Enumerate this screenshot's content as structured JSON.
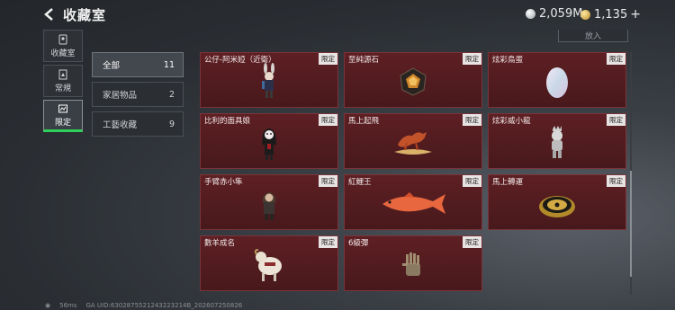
{
  "header": {
    "title": "收藏室",
    "currency_silver": "2,059M",
    "currency_gold": "1,135",
    "plus": "+"
  },
  "left_tabs": [
    {
      "label": "收藏室",
      "icon": "collection-icon"
    },
    {
      "label": "常規",
      "icon": "regular-icon"
    },
    {
      "label": "限定",
      "icon": "limited-icon",
      "active": true
    }
  ],
  "filters": [
    {
      "label": "全部",
      "count": "11",
      "active": true
    },
    {
      "label": "家居物品",
      "count": "2"
    },
    {
      "label": "工藝收藏",
      "count": "9"
    }
  ],
  "place_button": "放入",
  "items": [
    {
      "name": "公仔-阿米婭（近衛）",
      "badge": "限定",
      "icon": "rabbit-figurine-icon"
    },
    {
      "name": "至純源石",
      "badge": "限定",
      "icon": "originium-crystal-icon"
    },
    {
      "name": "炫彩鳥蛋",
      "badge": "限定",
      "icon": "iridescent-egg-icon"
    },
    {
      "name": "比利的面具娘",
      "badge": "限定",
      "icon": "masked-doll-icon"
    },
    {
      "name": "馬上起飛",
      "badge": "限定",
      "icon": "flying-horse-statue-icon"
    },
    {
      "name": "炫彩威小龍",
      "badge": "限定",
      "icon": "little-dragon-figure-icon"
    },
    {
      "name": "手臂赤小隼",
      "badge": "限定",
      "icon": "hooded-figure-icon"
    },
    {
      "name": "紅鯉王",
      "badge": "限定",
      "icon": "red-carp-icon"
    },
    {
      "name": "馬上轉運",
      "badge": "限定",
      "icon": "golden-compass-icon"
    },
    {
      "name": "數羊成名",
      "badge": "限定",
      "icon": "sheep-figure-icon"
    },
    {
      "name": "6級彈",
      "badge": "限定",
      "icon": "metal-hand-icon"
    }
  ],
  "footer": {
    "ping": "56ms",
    "uid": "GA UID:6302875521243223214B_202607250826"
  }
}
